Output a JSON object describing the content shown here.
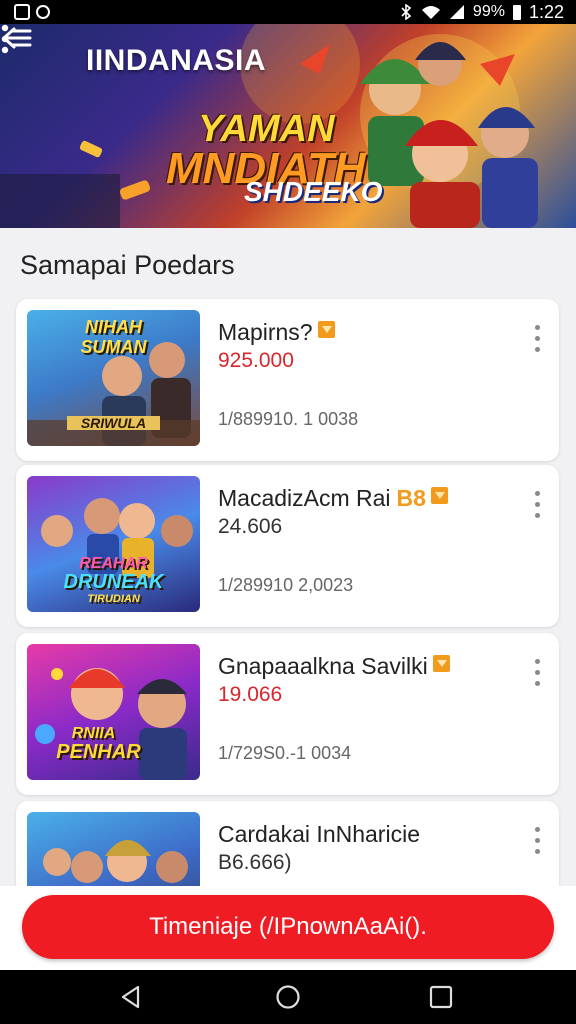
{
  "status_bar": {
    "battery": "99%",
    "time": "1:22"
  },
  "header": {
    "title": "IINDANASIA",
    "logo_lines": [
      "YAMAN",
      "MNDIATH",
      "SHDEEKO"
    ]
  },
  "section": {
    "title": "Samapai Poedars"
  },
  "items": [
    {
      "title": "Mapirns?",
      "badge_text": "",
      "price": "925.000",
      "price_highlight": true,
      "meta": "1/889910. 1 0038",
      "thumb_label_top": "NIHAH",
      "thumb_label_mid": "SUMAN",
      "thumb_label_bottom": "SRIWULA"
    },
    {
      "title": "MacadizAcm Rai",
      "badge_text": "B8",
      "price": "24.606",
      "price_highlight": false,
      "meta": "1/289910 2,0023",
      "thumb_label_top": "REAHAR",
      "thumb_label_mid": "DRUNEAK",
      "thumb_label_bottom": "TIRUDIAN"
    },
    {
      "title": "Gnapaaalkna Savilki",
      "badge_text": "",
      "price": "19.066",
      "price_highlight": true,
      "meta": "1/729S0.-1 0034",
      "thumb_label_top": "RNIIA",
      "thumb_label_mid": "PENHAR",
      "thumb_label_bottom": ""
    },
    {
      "title": "Cardakai InNharicie",
      "badge_text": "",
      "price": "B6.666)",
      "price_highlight": false,
      "meta": "",
      "thumb_label_top": "",
      "thumb_label_mid": "",
      "thumb_label_bottom": ""
    }
  ],
  "cta": {
    "label": "Timeniaje (/IPnownAaAi()."
  },
  "colors": {
    "accent": "#ef1c24",
    "price_red": "#d8262c",
    "badge_orange": "#f29a1c"
  }
}
